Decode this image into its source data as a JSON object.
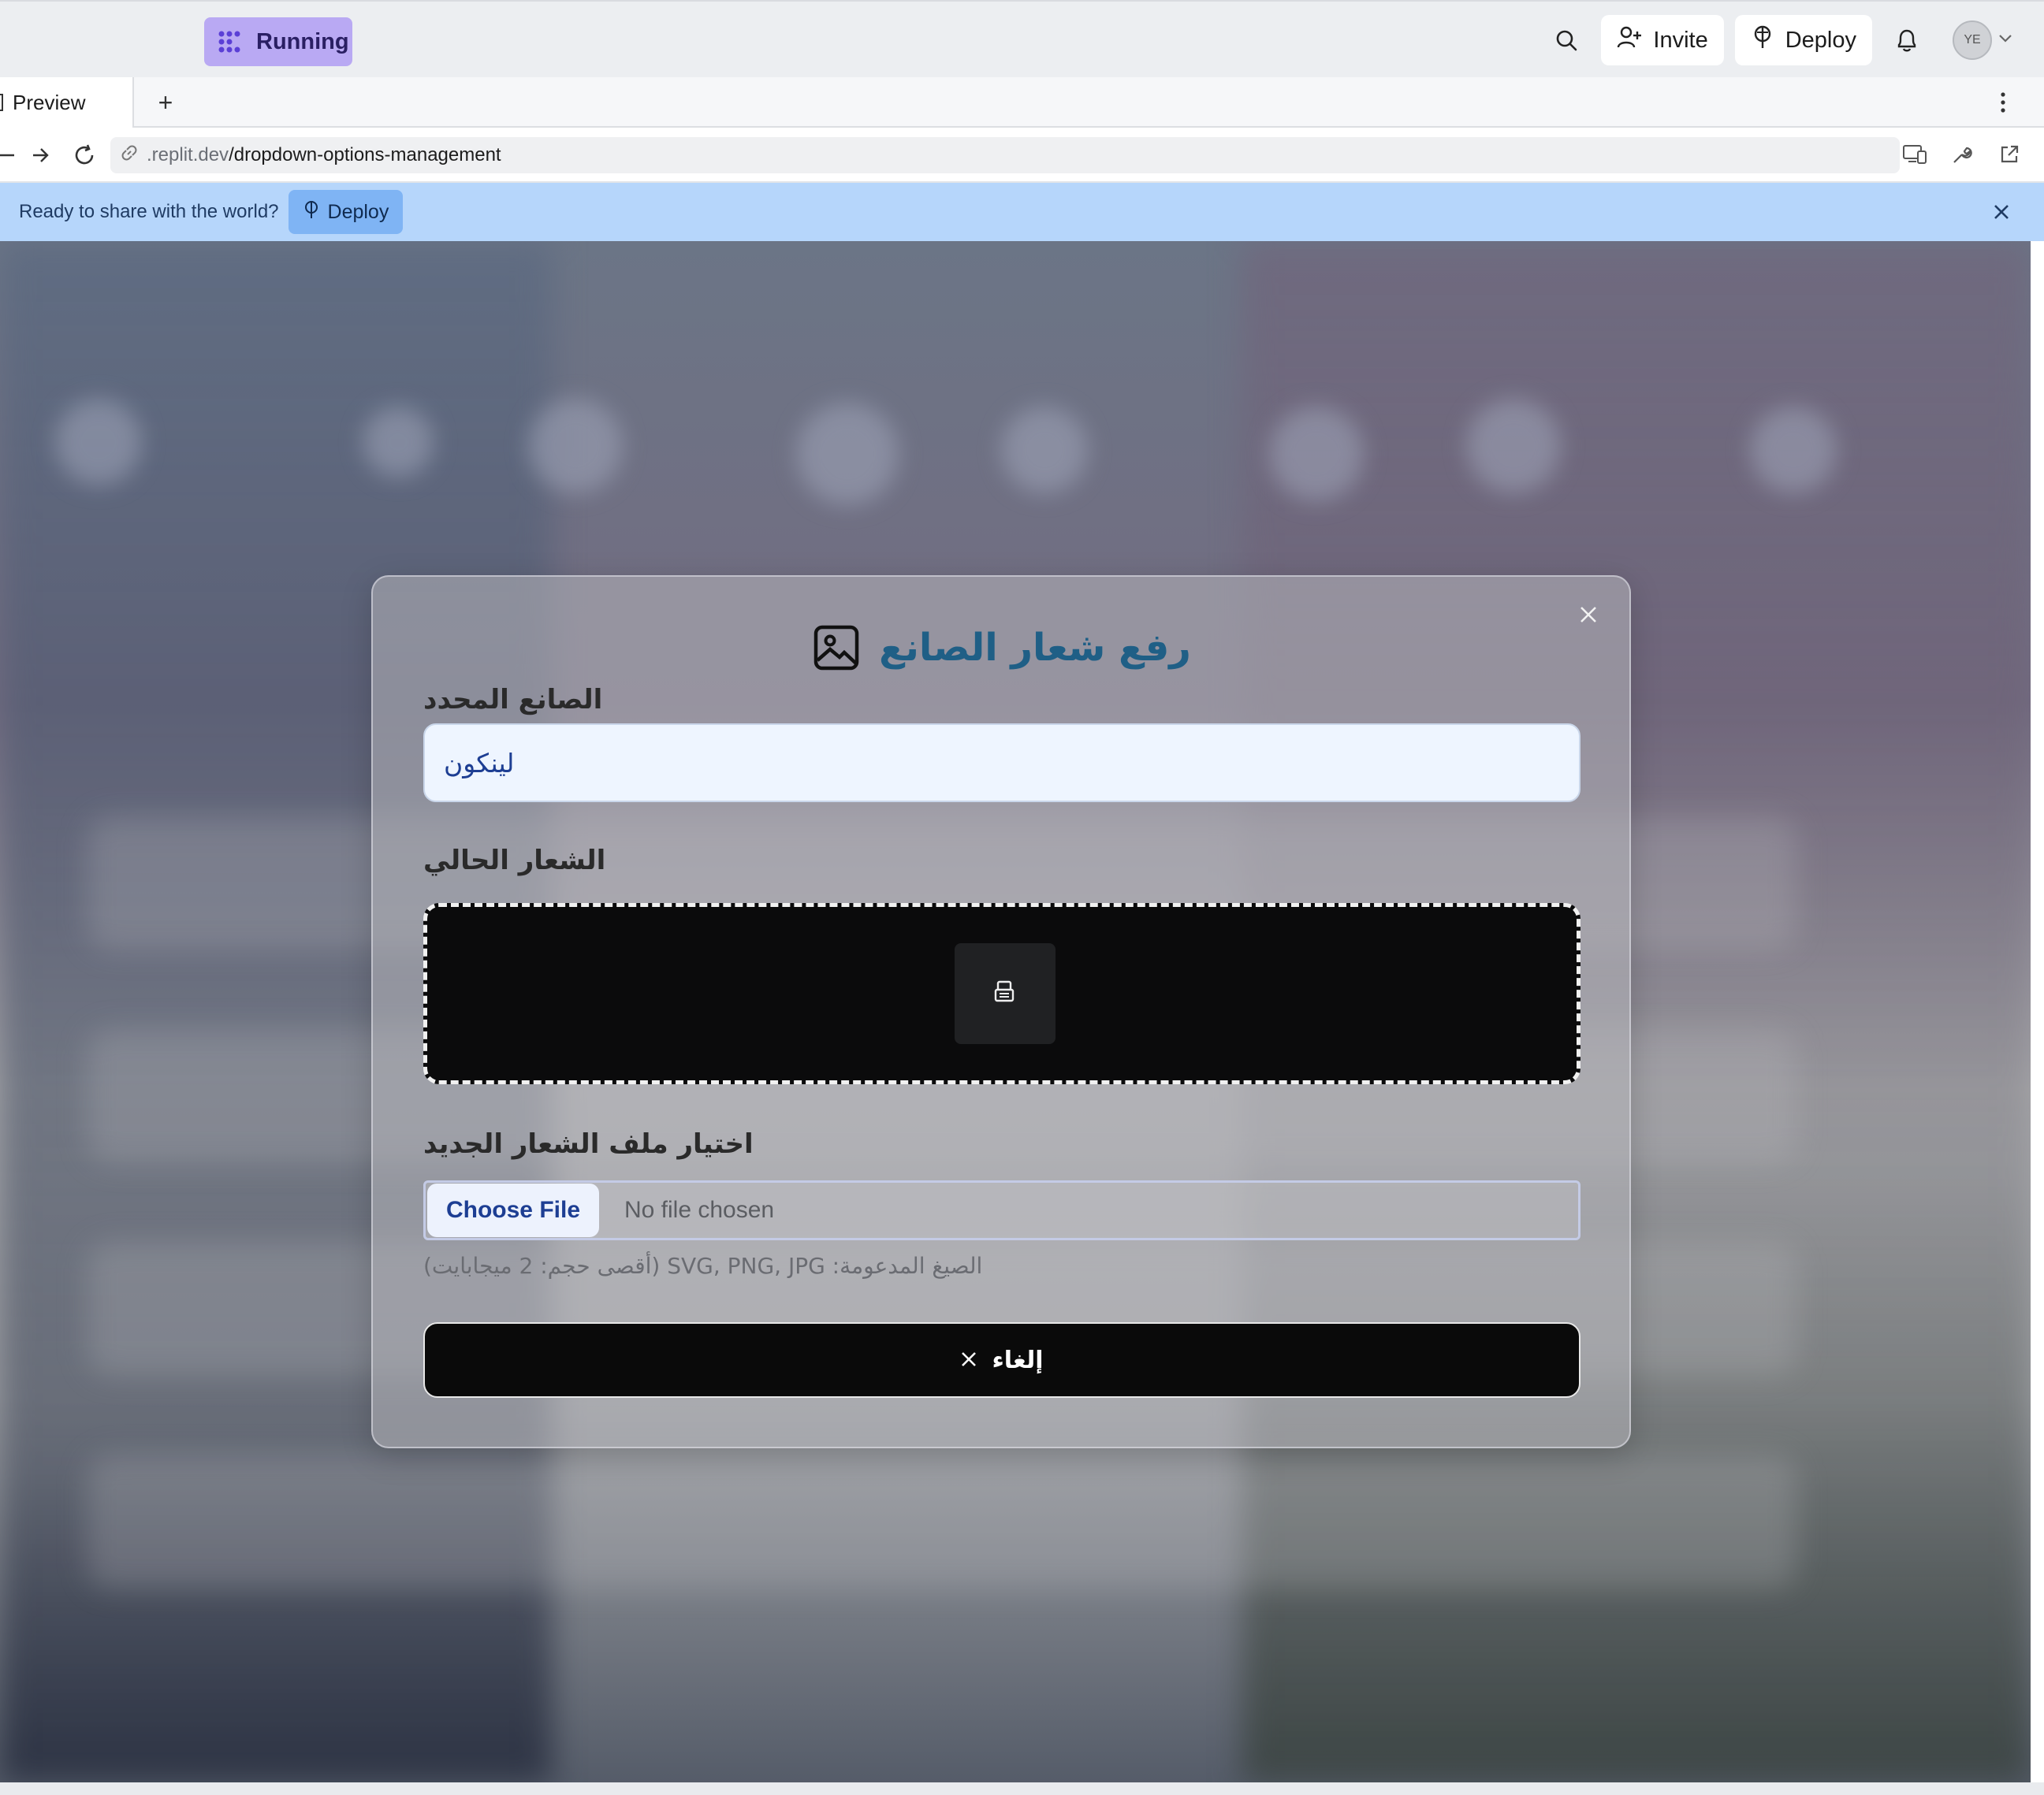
{
  "topbar": {
    "status_label": "Running",
    "invite_label": "Invite",
    "deploy_label": "Deploy",
    "avatar_initials": "YE"
  },
  "tabs": {
    "preview_label": "Preview",
    "add_label": "+"
  },
  "urlbar": {
    "host": ".replit.dev",
    "path": "/dropdown-options-management"
  },
  "banner": {
    "message": "Ready to share with the world?",
    "deploy_label": "Deploy"
  },
  "modal": {
    "title": "رفع شعار الصانع",
    "selected_maker_label": "الصانع المحدد",
    "selected_maker_value": "لينكون",
    "current_logo_label": "الشعار الحالي",
    "new_file_label": "اختيار ملف الشعار الجديد",
    "choose_file_label": "Choose File",
    "no_file_text": "No file chosen",
    "formats_hint": "الصيغ المدعومة: SVG, PNG, JPG (أقصى حجم: 2 ميجابايت)",
    "cancel_label": "إلغاء"
  },
  "colors": {
    "accent": "#b9a9f3",
    "banner": "#b6d6fb",
    "title": "#1f5f86"
  }
}
